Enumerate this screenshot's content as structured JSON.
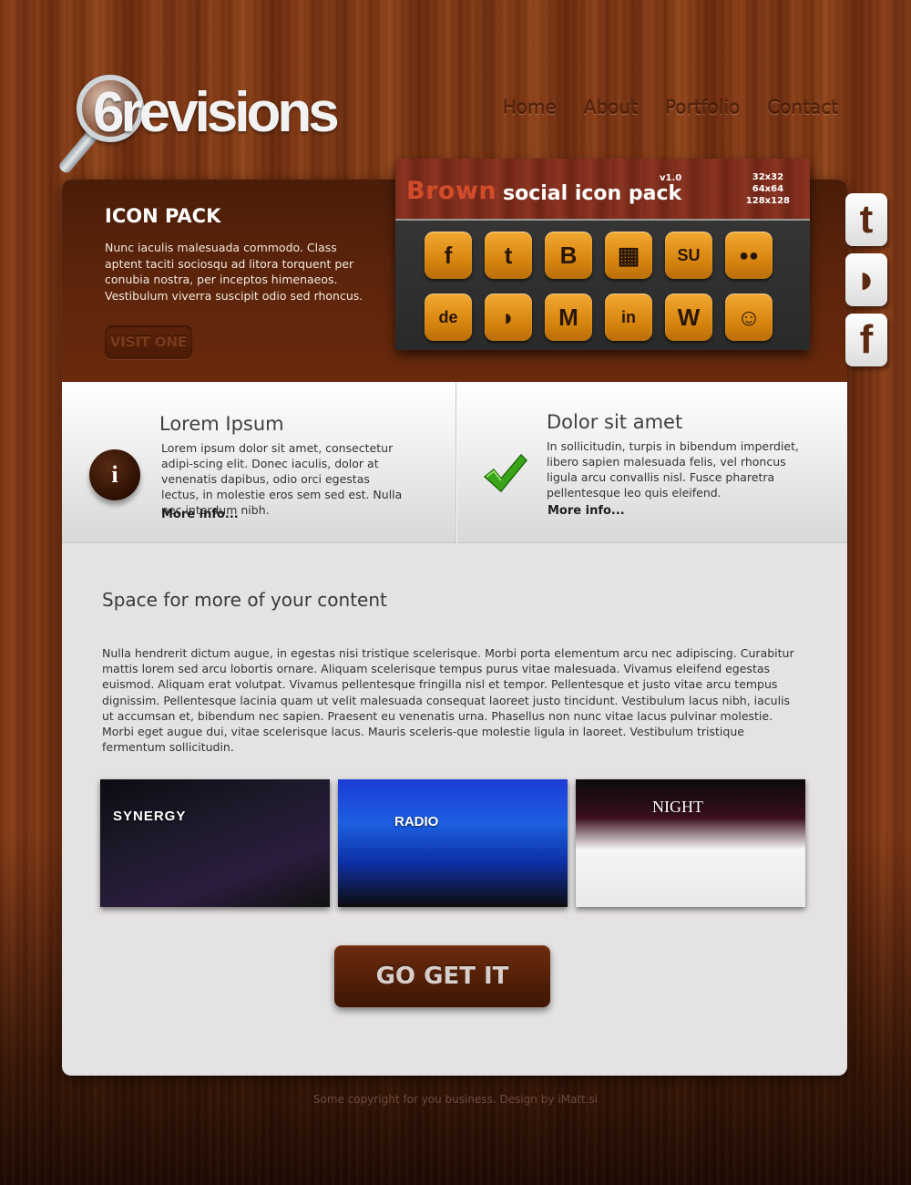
{
  "header": {
    "logo_text": "6revisions",
    "nav": [
      "Home",
      "About",
      "Portfolio",
      "Contact"
    ]
  },
  "social": [
    {
      "icon": "twitter-icon",
      "glyph": "t"
    },
    {
      "icon": "rss-icon",
      "glyph": "◗"
    },
    {
      "icon": "facebook-icon",
      "glyph": "f"
    }
  ],
  "hero": {
    "title": "ICON PACK",
    "text": "Nunc iaculis malesuada commodo. Class aptent taciti sociosqu ad litora torquent per conubia nostra, per inceptos himenaeos. Vestibulum viverra suscipit odio sed rhoncus.",
    "button": "VISIT ONE"
  },
  "icon_pack": {
    "brand": "Brown",
    "title": "social icon pack",
    "version": "v1.0",
    "sizes": [
      "32x32",
      "64x64",
      "128x128"
    ],
    "icons": [
      {
        "name": "facebook-icon",
        "glyph": "f"
      },
      {
        "name": "twitter-icon",
        "glyph": "t"
      },
      {
        "name": "blogger-icon",
        "glyph": "B"
      },
      {
        "name": "windows-icon",
        "glyph": "▦"
      },
      {
        "name": "stumbleupon-icon",
        "glyph": "SU"
      },
      {
        "name": "flickr-icon",
        "glyph": "●●"
      },
      {
        "name": "delicious-icon",
        "glyph": "de"
      },
      {
        "name": "rss-icon",
        "glyph": "◗"
      },
      {
        "name": "myspace-icon",
        "glyph": "M"
      },
      {
        "name": "linkedin-icon",
        "glyph": "in"
      },
      {
        "name": "wordpress-icon",
        "glyph": "W"
      },
      {
        "name": "reddit-icon",
        "glyph": "☺"
      }
    ]
  },
  "features": [
    {
      "title": "Lorem Ipsum",
      "text": "Lorem ipsum dolor sit amet, consectetur adipi-scing elit. Donec iaculis, dolor at venenatis dapibus, odio orci egestas lectus, in molestie eros sem sed est. Nulla nec interdum nibh.",
      "more": "More info..."
    },
    {
      "title": "Dolor sit amet",
      "text": "In sollicitudin, turpis in bibendum imperdiet, libero sapien malesuada felis, vel rhoncus ligula arcu convallis nisl. Fusce pharetra pellentesque leo quis eleifend.",
      "more": "More info..."
    }
  ],
  "content": {
    "title": "Space for more of your content",
    "text": "Nulla hendrerit dictum augue, in egestas nisi tristique scelerisque. Morbi porta elementum arcu nec adipiscing. Curabitur mattis lorem sed arcu lobortis ornare. Aliquam scelerisque tempus purus vitae malesuada. Vivamus eleifend egestas euismod. Aliquam erat volutpat. Vivamus pellentesque fringilla nisl et tempor. Pellentesque et justo vitae arcu tempus dignissim. Pellentesque lacinia quam ut velit malesuada consequat laoreet justo tincidunt. Vestibulum lacus nibh, iaculis ut accumsan et, bibendum nec sapien. Praesent eu venenatis urna. Phasellus non nunc vitae lacus pulvinar molestie. Morbi eget augue dui, vitae scelerisque lacus. Mauris sceleris-que molestie ligula in laoreet. Vestibulum tristique fermentum sollicitudin."
  },
  "shots": [
    {
      "label": "SYNERGY"
    },
    {
      "label": "RADIO"
    },
    {
      "label": "NIGHT"
    }
  ],
  "cta": "GO GET IT",
  "footer": "Some copyright for you business. Design by iMatt.si"
}
